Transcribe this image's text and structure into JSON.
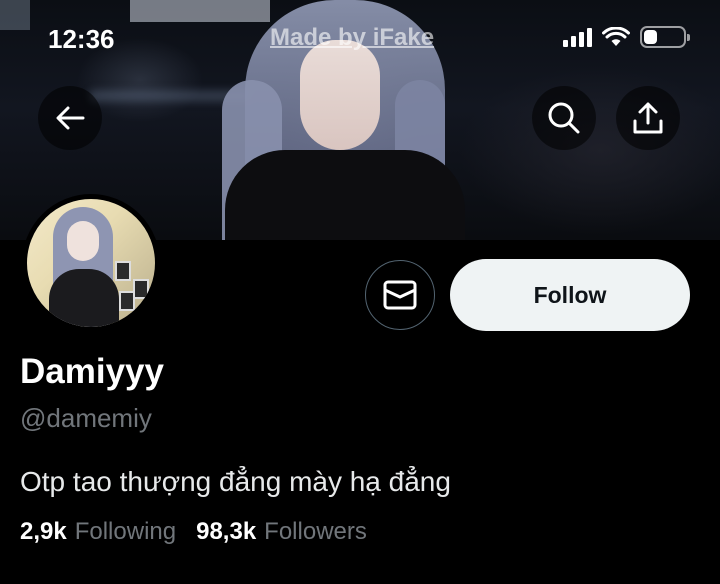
{
  "status_bar": {
    "time": "12:36",
    "watermark": "Made by iFake",
    "battery_level": 0.35
  },
  "nav": {
    "back_icon": "arrow-left-icon",
    "search_icon": "search-icon",
    "share_icon": "share-upload-icon"
  },
  "profile": {
    "display_name": "Damiyyy",
    "handle": "@damemiy",
    "bio": "Otp tao thượng đẳng mày hạ đẳng",
    "following_count": "2,9k",
    "following_label": "Following",
    "followers_count": "98,3k",
    "followers_label": "Followers"
  },
  "actions": {
    "message_icon": "envelope-icon",
    "follow_label": "Follow"
  },
  "colors": {
    "background": "#000000",
    "primary_text": "#e7e9ea",
    "secondary_text": "#71767b",
    "follow_button_bg": "#eff3f4",
    "follow_button_text": "#0f1419"
  }
}
